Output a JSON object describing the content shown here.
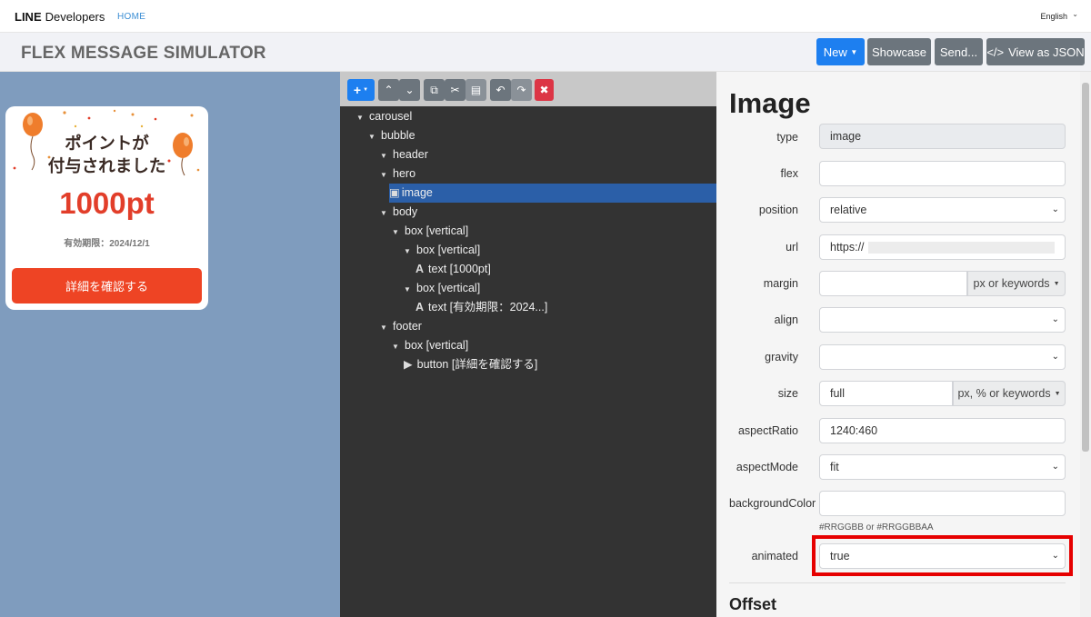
{
  "nav": {
    "brand_bold": "LINE",
    "brand_rest": "Developers",
    "home": "HOME",
    "language": "English"
  },
  "header": {
    "title": "FLEX MESSAGE SIMULATOR",
    "buttons": {
      "new": "New",
      "showcase": "Showcase",
      "send": "Send...",
      "view_json": "View as JSON"
    }
  },
  "preview": {
    "hero_line1": "ポイントが",
    "hero_line2": "付与されました",
    "points": "1000pt",
    "expiry": "有効期限：2024/12/1",
    "cta": "詳細を確認する"
  },
  "tree": {
    "nodes": [
      {
        "label": "carousel"
      },
      {
        "label": "bubble"
      },
      {
        "label": "header"
      },
      {
        "label": "hero"
      },
      {
        "label": "image"
      },
      {
        "label": "body"
      },
      {
        "label": "box [vertical]"
      },
      {
        "label": "box [vertical]"
      },
      {
        "label": "text [1000pt]"
      },
      {
        "label": "box [vertical]"
      },
      {
        "label": "text [有効期限：2024...]"
      },
      {
        "label": "footer"
      },
      {
        "label": "box [vertical]"
      },
      {
        "label": "button [詳細を確認する]"
      }
    ]
  },
  "props": {
    "title": "Image",
    "fields": {
      "type": {
        "label": "type",
        "value": "image"
      },
      "flex": {
        "label": "flex",
        "value": ""
      },
      "position": {
        "label": "position",
        "value": "relative"
      },
      "url": {
        "label": "url",
        "value": "https://"
      },
      "margin": {
        "label": "margin",
        "value": "",
        "addon": "px or keywords"
      },
      "align": {
        "label": "align",
        "value": ""
      },
      "gravity": {
        "label": "gravity",
        "value": ""
      },
      "size": {
        "label": "size",
        "value": "full",
        "addon": "px, % or keywords"
      },
      "aspectRatio": {
        "label": "aspectRatio",
        "value": "1240:460"
      },
      "aspectMode": {
        "label": "aspectMode",
        "value": "fit"
      },
      "backgroundColor": {
        "label": "backgroundColor",
        "value": "",
        "hint": "#RRGGBB or #RRGGBBAA"
      },
      "animated": {
        "label": "animated",
        "value": "true"
      }
    },
    "offset_title": "Offset"
  }
}
